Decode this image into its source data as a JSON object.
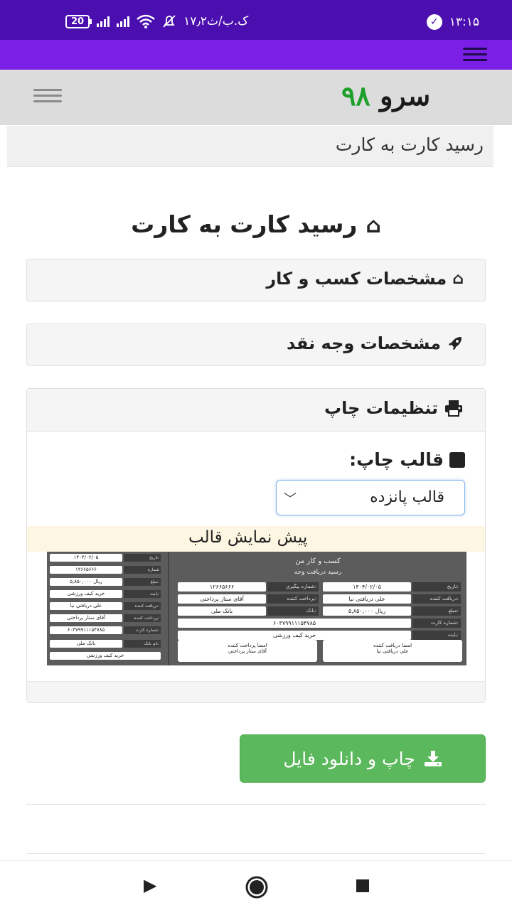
{
  "status_bar": {
    "time": "۱۳:۱۵",
    "network_speed": "۱۷٫۲ک.ب/ث",
    "battery": "20"
  },
  "site": {
    "logo_word": "سرو",
    "logo_number": "۹۸"
  },
  "breadcrumb": "رسید کارت به کارت",
  "page_title": "رسید کارت به کارت",
  "panels": {
    "business": "مشخصات کسب و کار",
    "cash": "مشخصات وجه نقد",
    "print": "تنظیمات چاپ"
  },
  "print_settings": {
    "template_label": "قالب چاپ:",
    "template_selected": "قالب پانزده",
    "preview_label": "پیش نمایش قالب"
  },
  "receipt_preview": {
    "stub_rows": [
      {
        "label": "تاریخ:",
        "value": "۱۴۰۴/۰۲/۰۵"
      },
      {
        "label": "شماره",
        "value": "۱۲۶۶۵۶۶۶"
      },
      {
        "label": "مبلغ:",
        "value": "۵,۸۵۰,۰۰۰ ریال"
      },
      {
        "label": "بابت:",
        "value": "خرید کیف ورزشی"
      },
      {
        "label": "دریافت کننده:",
        "value": "علی دریافتی نیا"
      },
      {
        "label": "پرداخت کننده:",
        "value": "آقای ستار پرداختی"
      },
      {
        "label": "شماره کارت:",
        "value": "۶۰۳۷۹۹۱۱۱۵۴۷۸۵"
      },
      {
        "label": "نام بانک:",
        "value": "بانک ملی"
      },
      {
        "label": "",
        "value": "خرید کیف ورزشی"
      }
    ],
    "title": "کسب و کار من",
    "subtitle": "رسید دریافت وجه",
    "date_label": "تاریخ:",
    "date": "۱۴۰۴/۰۲/۰۵",
    "tracking_label": "شماره پیگیری:",
    "tracking": "۱۲۶۶۵۶۶۶",
    "receiver_label": "دریافت کننده:",
    "receiver": "علی دریافتی نیا",
    "payer_label": "پرداخت کننده:",
    "payer": "آقای ستار پرداختی",
    "amount_label": "مبلغ:",
    "amount": "۵,۸۵۰,۰۰۰ ریال",
    "bank_label": "بانک:",
    "bank": "بانک ملی",
    "card_label": "شماره کارت:",
    "card": "۶۰۳۷۹۹۱۱۱۵۴۷۸۵",
    "for_label": "بابت:",
    "for": "خرید کیف ورزشی",
    "sig_receiver_title": "امضا دریافت کننده",
    "sig_receiver_name": "علی دریافتی نیا",
    "sig_payer_title": "امضا پرداخت کننده",
    "sig_payer_name": "آقای ستار پرداختی"
  },
  "actions": {
    "print_download": "چاپ و دانلود فایل"
  },
  "icons": {
    "home": "home-icon",
    "rocket": "rocket-icon",
    "printer": "printer-icon",
    "download": "download-icon"
  },
  "colors": {
    "status_bar": "#4a0fae",
    "nav_bar": "#7b1fe6",
    "logo_accent": "#1ba02a",
    "button": "#5cb85c"
  }
}
